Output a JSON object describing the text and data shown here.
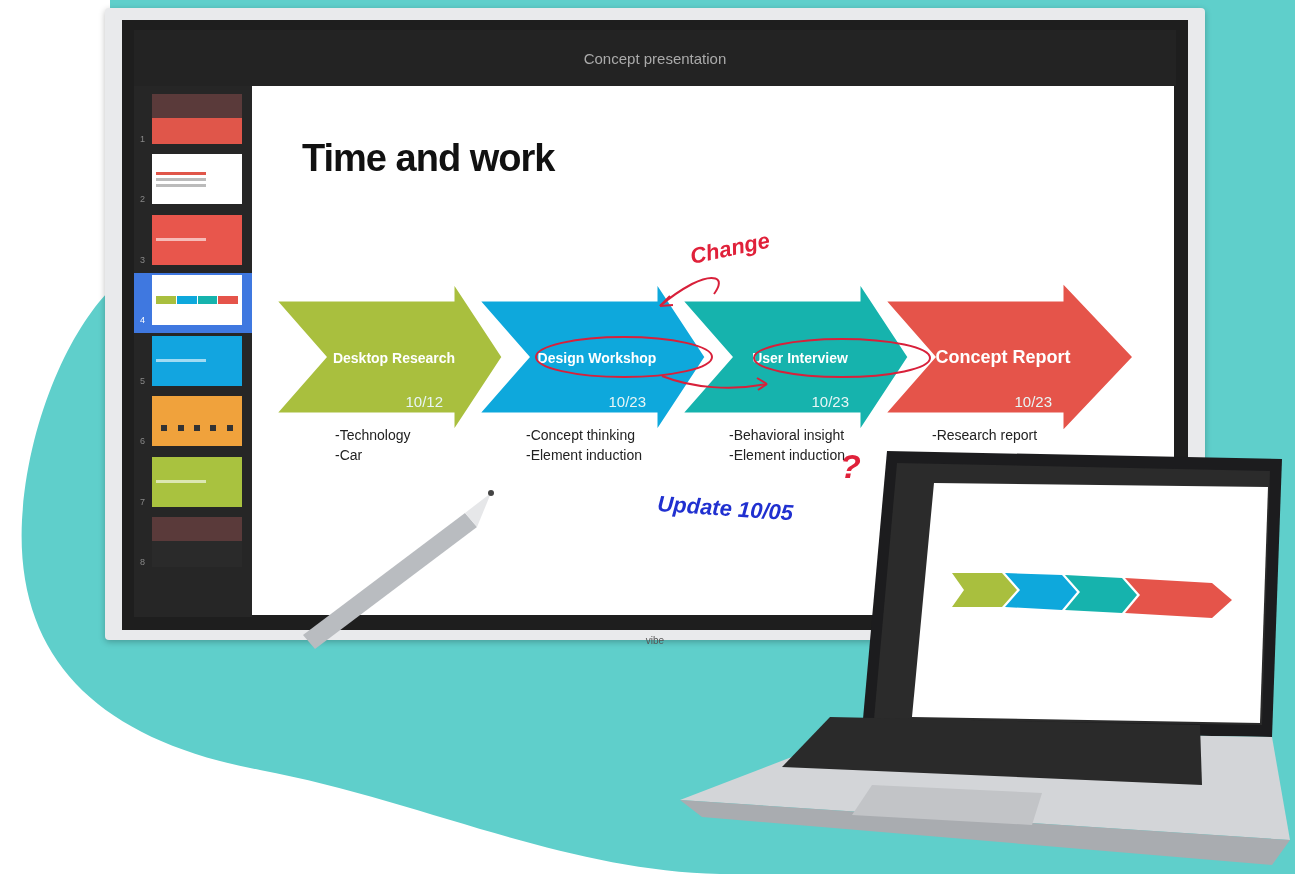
{
  "window": {
    "title": "Concept presentation"
  },
  "slides": [
    {
      "number": "1",
      "kind": "photo",
      "color": "#e0564a",
      "selected": false
    },
    {
      "number": "2",
      "kind": "text",
      "color": "#ffffff",
      "selected": false
    },
    {
      "number": "3",
      "kind": "section",
      "color": "#e8564c",
      "selected": false
    },
    {
      "number": "4",
      "kind": "arrows",
      "color": "#ffffff",
      "selected": true
    },
    {
      "number": "5",
      "kind": "section",
      "color": "#12a5e0",
      "selected": false
    },
    {
      "number": "6",
      "kind": "icons",
      "color": "#f0a23c",
      "selected": false
    },
    {
      "number": "7",
      "kind": "section",
      "color": "#a9c23f",
      "selected": false
    },
    {
      "number": "8",
      "kind": "photo",
      "color": "#2a2a2a",
      "selected": false
    }
  ],
  "slide": {
    "title": "Time and work",
    "steps": [
      {
        "label": "Desktop Research",
        "date": "10/12",
        "color": "#a9bf3e",
        "notes": [
          "-Technology",
          "-Car"
        ]
      },
      {
        "label": "Design Workshop",
        "date": "10/23",
        "color": "#0ea8dc",
        "notes": [
          "-Concept thinking",
          "-Element induction"
        ]
      },
      {
        "label": "User Interview",
        "date": "10/23",
        "color": "#16b3ad",
        "notes": [
          "-Behavioral insight",
          "-Element induction"
        ]
      },
      {
        "label": "Concept Report",
        "date": "10/23",
        "color": "#e5544a",
        "notes": [
          "-Research report"
        ]
      }
    ],
    "annotations": [
      {
        "kind": "text",
        "text": "Change",
        "color": "#e0213a"
      },
      {
        "kind": "text",
        "text": "?",
        "color": "#e0213a"
      },
      {
        "kind": "text",
        "text": "Update 10/05",
        "color": "#2030d0"
      }
    ]
  },
  "device": {
    "brand": "vibe"
  }
}
